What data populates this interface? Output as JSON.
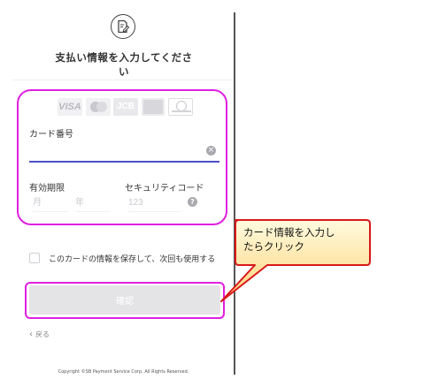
{
  "header": {
    "icon": "document-edit-icon",
    "title": "支払い情報を入力してください"
  },
  "card_form": {
    "brands": [
      "VISA",
      "Mastercard",
      "JCB",
      "American Express",
      "Diners Club"
    ],
    "visa_text": "VISA",
    "jcb_text": "JCB",
    "card_number_label": "カード番号",
    "card_number_value": "",
    "clear_symbol": "×",
    "expiry_label": "有効期限",
    "month_placeholder": "月",
    "year_placeholder": "年",
    "security_label": "セキュリティコード",
    "security_placeholder": "123",
    "help_symbol": "?"
  },
  "save_option": {
    "checked": false,
    "label": "このカードの情報を保存して、次回も使用する"
  },
  "confirm_button": "確認",
  "back_link": "戻る",
  "back_chevron": "‹",
  "copyright": "Copyright ©SB Payment Service Corp. All Rights Reserved.",
  "callout": {
    "line1": "カード情報を入力し",
    "line2": "たらクリック"
  },
  "colors": {
    "highlight": "#e020e0",
    "input_underline": "#4a4fc4",
    "callout_border": "#d81818",
    "callout_fill_top": "#fffbe0",
    "callout_fill_bottom": "#ffd277"
  }
}
